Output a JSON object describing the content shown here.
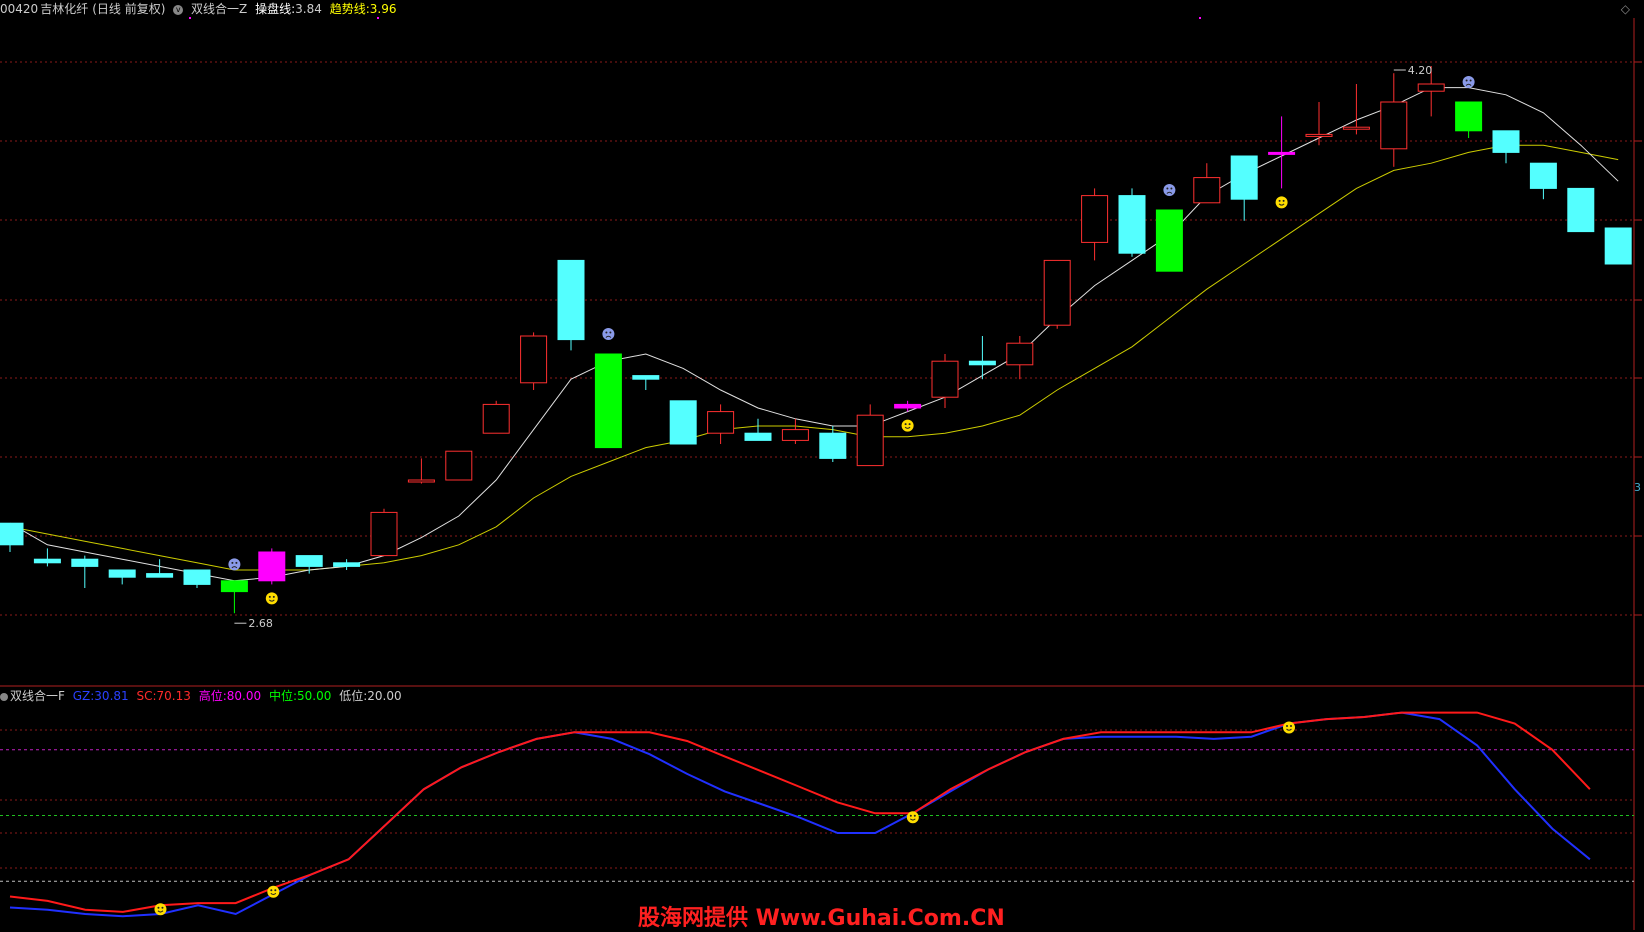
{
  "header": {
    "code": "00420",
    "name": "吉林化纤",
    "period": "(日线 前复权)",
    "formula": "双线合一Z",
    "ops_label": "操盘线:",
    "ops_value": "3.84",
    "trend_label": "趋势线:",
    "trend_value": "3.96",
    "corner_icon": "diamond-icon"
  },
  "indicator_header": {
    "name": "双线合一F",
    "gz_label": "GZ:",
    "gz_value": "30.81",
    "sc_label": "SC:",
    "sc_value": "70.13",
    "high_label": "高位:",
    "high_value": "80.00",
    "mid_label": "中位:",
    "mid_value": "50.00",
    "low_label": "低位:",
    "low_value": "20.00"
  },
  "annotations": {
    "low_mark": "2.68",
    "high_mark": "4.20",
    "edge_mark": "3"
  },
  "watermark": "股海网提供 Www.Guhai.Com.CN",
  "colors": {
    "up": "#ff3030",
    "down": "#54ffff",
    "buy_bar": "#ff00ff",
    "sell_bar": "#00ff00",
    "ma_white": "#e0e0e0",
    "ma_yellow": "#cccc00",
    "gz": "#2030ff",
    "sc": "#ff1a1a"
  },
  "chart_data": {
    "type": "candlestick",
    "price_range": [
      2.55,
      4.3
    ],
    "candles": [
      {
        "o": 2.93,
        "h": 2.93,
        "l": 2.85,
        "c": 2.87
      },
      {
        "o": 2.83,
        "h": 2.86,
        "l": 2.81,
        "c": 2.82
      },
      {
        "o": 2.83,
        "h": 2.84,
        "l": 2.75,
        "c": 2.81
      },
      {
        "o": 2.8,
        "h": 2.8,
        "l": 2.76,
        "c": 2.78
      },
      {
        "o": 2.79,
        "h": 2.83,
        "l": 2.78,
        "c": 2.78
      },
      {
        "o": 2.8,
        "h": 2.8,
        "l": 2.75,
        "c": 2.76
      },
      {
        "o": 2.74,
        "h": 2.76,
        "l": 2.68,
        "c": 2.77,
        "mark": "sell"
      },
      {
        "o": 2.77,
        "h": 2.86,
        "l": 2.76,
        "c": 2.85,
        "mark": "buy"
      },
      {
        "o": 2.84,
        "h": 2.84,
        "l": 2.79,
        "c": 2.81
      },
      {
        "o": 2.82,
        "h": 2.83,
        "l": 2.8,
        "c": 2.81
      },
      {
        "o": 2.84,
        "h": 2.97,
        "l": 2.84,
        "c": 2.96
      },
      {
        "o": 3.05,
        "h": 3.11,
        "l": 3.04,
        "c": 3.05
      },
      {
        "o": 3.05,
        "h": 3.13,
        "l": 3.05,
        "c": 3.13
      },
      {
        "o": 3.18,
        "h": 3.27,
        "l": 3.18,
        "c": 3.26
      },
      {
        "o": 3.32,
        "h": 3.46,
        "l": 3.3,
        "c": 3.45
      },
      {
        "o": 3.66,
        "h": 3.66,
        "l": 3.41,
        "c": 3.44
      },
      {
        "o": 3.4,
        "h": 3.4,
        "l": 3.14,
        "c": 3.14,
        "mark": "sell"
      },
      {
        "o": 3.34,
        "h": 3.34,
        "l": 3.3,
        "c": 3.33
      },
      {
        "o": 3.27,
        "h": 3.27,
        "l": 3.16,
        "c": 3.15
      },
      {
        "o": 3.18,
        "h": 3.26,
        "l": 3.15,
        "c": 3.24
      },
      {
        "o": 3.18,
        "h": 3.22,
        "l": 3.16,
        "c": 3.16
      },
      {
        "o": 3.16,
        "h": 3.22,
        "l": 3.15,
        "c": 3.19
      },
      {
        "o": 3.18,
        "h": 3.2,
        "l": 3.1,
        "c": 3.11
      },
      {
        "o": 3.09,
        "h": 3.26,
        "l": 3.09,
        "c": 3.23
      },
      {
        "o": 3.26,
        "h": 3.27,
        "l": 3.24,
        "c": 3.25,
        "mark": "buy"
      },
      {
        "o": 3.28,
        "h": 3.4,
        "l": 3.25,
        "c": 3.38
      },
      {
        "o": 3.38,
        "h": 3.45,
        "l": 3.33,
        "c": 3.37
      },
      {
        "o": 3.37,
        "h": 3.45,
        "l": 3.33,
        "c": 3.43
      },
      {
        "o": 3.48,
        "h": 3.61,
        "l": 3.47,
        "c": 3.66
      },
      {
        "o": 3.71,
        "h": 3.86,
        "l": 3.66,
        "c": 3.84
      },
      {
        "o": 3.84,
        "h": 3.86,
        "l": 3.67,
        "c": 3.68
      },
      {
        "o": 3.8,
        "h": 3.8,
        "l": 3.63,
        "c": 3.63,
        "mark": "sell"
      },
      {
        "o": 3.82,
        "h": 3.93,
        "l": 3.82,
        "c": 3.89
      },
      {
        "o": 3.95,
        "h": 3.95,
        "l": 3.77,
        "c": 3.83
      },
      {
        "o": 3.96,
        "h": 4.06,
        "l": 3.86,
        "c": 3.96,
        "mark": "buy"
      },
      {
        "o": 4.01,
        "h": 4.1,
        "l": 3.98,
        "c": 4.01
      },
      {
        "o": 4.03,
        "h": 4.15,
        "l": 4.01,
        "c": 4.03
      },
      {
        "o": 3.97,
        "h": 4.18,
        "l": 3.92,
        "c": 4.1
      },
      {
        "o": 4.13,
        "h": 4.2,
        "l": 4.06,
        "c": 4.15
      },
      {
        "o": 4.1,
        "h": 4.1,
        "l": 4.0,
        "c": 4.02,
        "mark": "sell"
      },
      {
        "o": 4.02,
        "h": 4.02,
        "l": 3.93,
        "c": 3.96
      },
      {
        "o": 3.93,
        "h": 3.93,
        "l": 3.83,
        "c": 3.86
      },
      {
        "o": 3.86,
        "h": 3.86,
        "l": 3.74,
        "c": 3.74
      },
      {
        "o": 3.75,
        "h": 3.75,
        "l": 3.65,
        "c": 3.65
      }
    ],
    "ma_white": [
      2.93,
      2.87,
      2.85,
      2.83,
      2.81,
      2.79,
      2.77,
      2.78,
      2.8,
      2.81,
      2.84,
      2.89,
      2.95,
      3.05,
      3.19,
      3.33,
      3.38,
      3.4,
      3.36,
      3.3,
      3.25,
      3.22,
      3.2,
      3.2,
      3.24,
      3.28,
      3.34,
      3.4,
      3.5,
      3.59,
      3.66,
      3.73,
      3.84,
      3.9,
      3.95,
      4.0,
      4.05,
      4.09,
      4.14,
      4.14,
      4.12,
      4.07,
      3.98,
      3.88
    ],
    "ma_yellow": [
      2.92,
      2.9,
      2.88,
      2.86,
      2.84,
      2.82,
      2.8,
      2.8,
      2.8,
      2.81,
      2.82,
      2.84,
      2.87,
      2.92,
      3.0,
      3.06,
      3.1,
      3.14,
      3.16,
      3.19,
      3.2,
      3.2,
      3.19,
      3.17,
      3.17,
      3.18,
      3.2,
      3.23,
      3.3,
      3.36,
      3.42,
      3.5,
      3.58,
      3.65,
      3.72,
      3.79,
      3.86,
      3.91,
      3.93,
      3.96,
      3.98,
      3.98,
      3.96,
      3.94
    ],
    "gz": [
      8,
      7,
      5,
      4,
      5,
      9,
      5,
      14,
      23,
      30,
      46,
      62,
      72,
      79,
      85,
      88,
      85,
      78,
      69,
      61,
      55,
      49,
      42,
      42,
      51,
      61,
      71,
      79,
      85,
      86,
      86,
      86,
      85,
      86,
      92,
      94,
      95,
      97,
      94,
      82,
      62,
      44,
      30
    ],
    "sc": [
      13,
      11,
      7,
      6,
      9,
      10,
      10,
      17,
      23,
      30,
      46,
      62,
      72,
      79,
      85,
      88,
      88,
      88,
      84,
      77,
      70,
      63,
      56,
      51,
      51,
      62,
      71,
      79,
      85,
      88,
      88,
      88,
      88,
      88,
      92,
      94,
      95,
      97,
      97,
      97,
      92,
      80,
      62
    ],
    "levels": {
      "high": 80,
      "mid": 50,
      "low": 20
    }
  }
}
